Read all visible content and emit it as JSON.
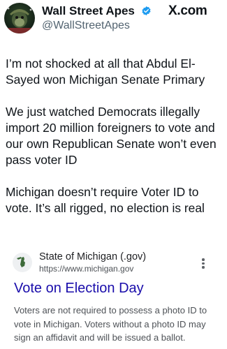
{
  "tweet": {
    "display_name": "Wall Street Apes",
    "handle": "@WallStreetApes",
    "platform": "X.com",
    "paragraphs": [
      "I’m not shocked at all that Abdul El-Sayed won Michigan Senate Primary",
      "We just watched Democrats illegally import 20 million foreigners to vote and our own Republican Senate won’t even pass voter ID",
      "Michigan doesn’t require Voter ID to vote. It’s all rigged, no election is real"
    ]
  },
  "search_result": {
    "site_name": "State of Michigan (.gov)",
    "url": "https://www.michigan.gov",
    "title": "Vote on Election Day",
    "snippet": "Voters are not required to possess a photo ID to vote in Michigan. Voters without a photo ID may sign an affidavit and will be issued a ballot."
  },
  "colors": {
    "verified": "#1d9bf0",
    "link_title": "#1a0dab",
    "handle": "#536471",
    "snippet": "#4d5156"
  }
}
